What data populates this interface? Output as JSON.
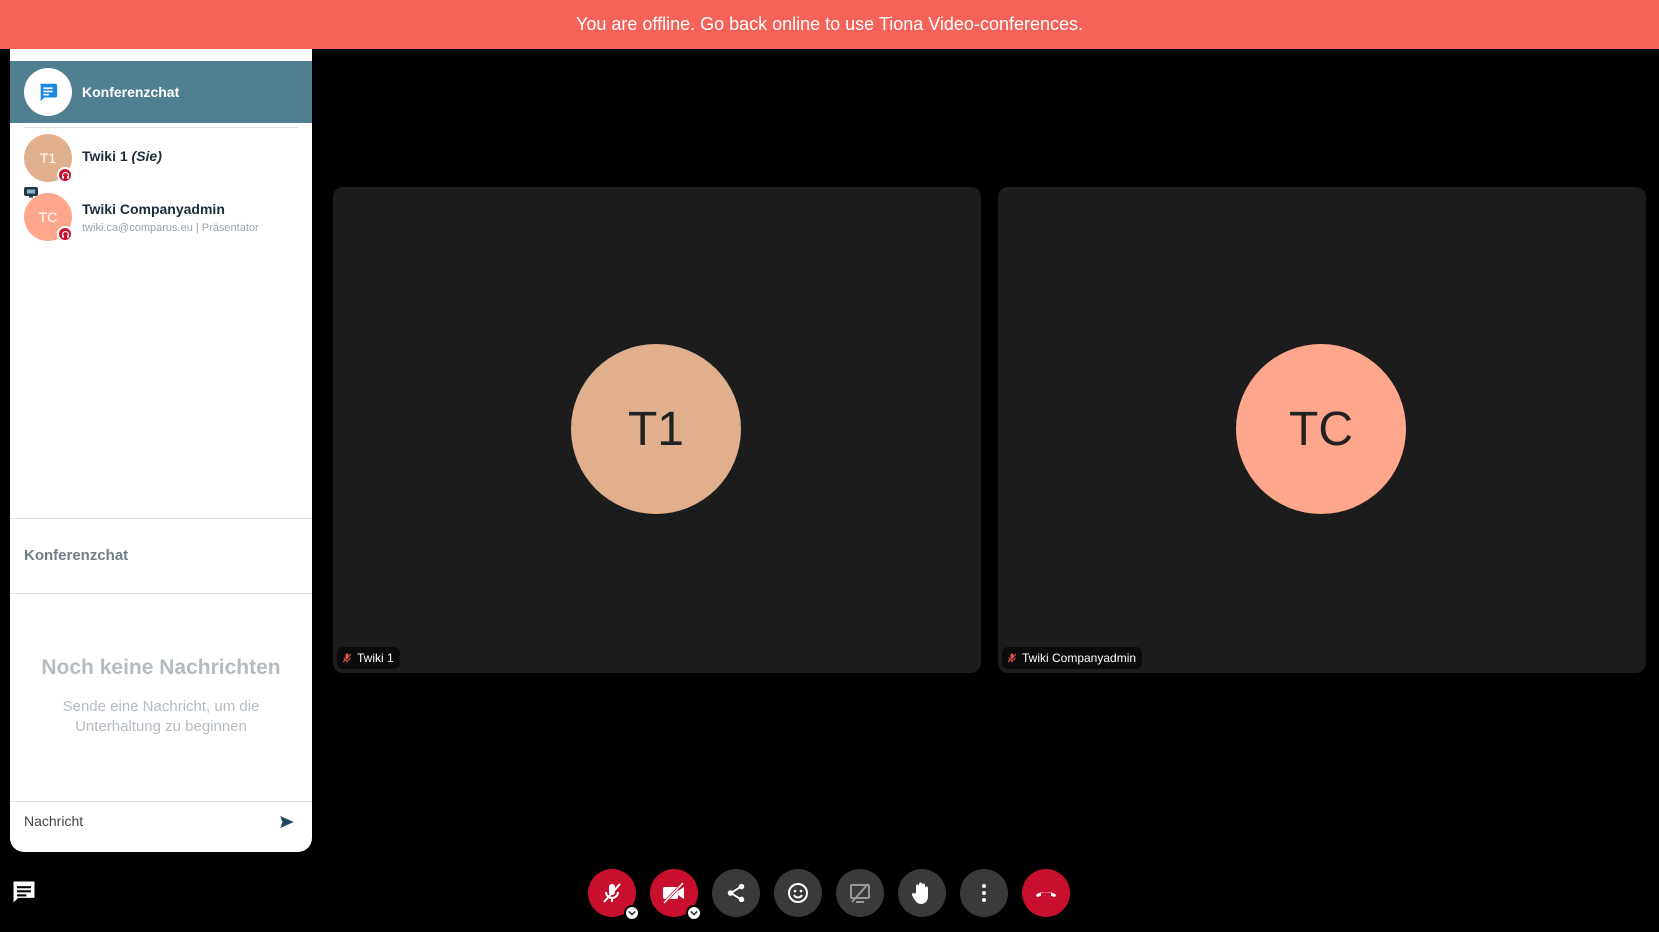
{
  "banner": {
    "text": "You are offline. Go back online to use Tiona Video-conferences."
  },
  "sidebar": {
    "chat_header_label": "Konferenzchat",
    "participants": [
      {
        "initials": "T1",
        "name": "Twiki 1",
        "you_suffix": "(Sie)",
        "subtitle": "",
        "avatar_color": "#e0b08e"
      },
      {
        "initials": "TC",
        "name": "Twiki Companyadmin",
        "you_suffix": "",
        "subtitle": "twiki.ca@comparus.eu | Präsentator",
        "avatar_color": "#ffa78c"
      }
    ],
    "section_label": "Konferenzchat",
    "empty_title": "Noch keine Nachrichten",
    "empty_subtitle": "Sende eine Nachricht, um die Unterhaltung zu beginnen",
    "message_placeholder": "Nachricht"
  },
  "tiles": [
    {
      "initials": "T1",
      "label": "Twiki 1",
      "avatar_color": "#e0b08e",
      "muted": true
    },
    {
      "initials": "TC",
      "label": "Twiki Companyadmin",
      "avatar_color": "#ffa78c",
      "muted": true
    }
  ],
  "toolbar": {
    "buttons": [
      {
        "name": "microphone-muted",
        "icon": "mic-off-icon",
        "color": "#c8102e"
      },
      {
        "name": "camera-off",
        "icon": "video-off-icon",
        "color": "#c8102e"
      },
      {
        "name": "share",
        "icon": "share-icon",
        "color": "#3a3a3a"
      },
      {
        "name": "reactions",
        "icon": "emoji-icon",
        "color": "#3a3a3a"
      },
      {
        "name": "screen-share-off",
        "icon": "screen-share-off-icon",
        "color": "#3a3a3a"
      },
      {
        "name": "raise-hand",
        "icon": "hand-icon",
        "color": "#3a3a3a"
      },
      {
        "name": "more",
        "icon": "more-vertical-icon",
        "color": "#3a3a3a"
      },
      {
        "name": "hang-up",
        "icon": "hang-up-icon",
        "color": "#c8102e"
      }
    ]
  },
  "colors": {
    "banner": "#f46258",
    "header": "#4f7f91",
    "accent_red": "#c8102e"
  }
}
